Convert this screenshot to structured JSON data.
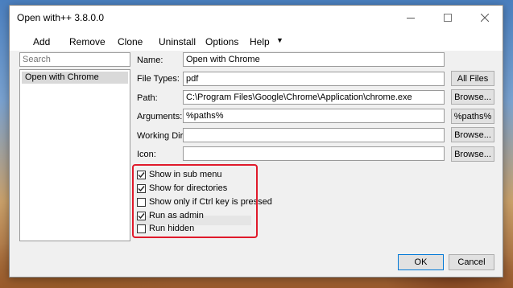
{
  "window": {
    "title": "Open with++ 3.8.0.0"
  },
  "menu": {
    "items": [
      "Add",
      "Remove",
      "Clone",
      "Uninstall",
      "Options",
      "Help"
    ],
    "dropdown_icon": "triangle-down-icon"
  },
  "sidebar": {
    "search_placeholder": "Search",
    "items": [
      {
        "label": "Open with Chrome",
        "selected": true
      }
    ]
  },
  "form": {
    "name": {
      "label": "Name:",
      "value": "Open with Chrome"
    },
    "file_types": {
      "label": "File Types:",
      "value": "pdf",
      "button": "All Files"
    },
    "path": {
      "label": "Path:",
      "value": "C:\\Program Files\\Google\\Chrome\\Application\\chrome.exe",
      "button": "Browse..."
    },
    "arguments": {
      "label": "Arguments:",
      "value": "%paths%",
      "button": "%paths%"
    },
    "working_dir": {
      "label": "Working Dir:",
      "value": "",
      "button": "Browse..."
    },
    "icon": {
      "label": "Icon:",
      "value": "",
      "button": "Browse..."
    }
  },
  "options": [
    {
      "label": "Show in sub menu",
      "checked": true
    },
    {
      "label": "Show for directories",
      "checked": true
    },
    {
      "label": "Show only if Ctrl key is pressed",
      "checked": false
    },
    {
      "label": "Run as admin",
      "checked": true
    },
    {
      "label": "Run hidden",
      "checked": false
    }
  ],
  "highlight_color": "#e01a2b",
  "footer": {
    "ok": "OK",
    "cancel": "Cancel"
  }
}
